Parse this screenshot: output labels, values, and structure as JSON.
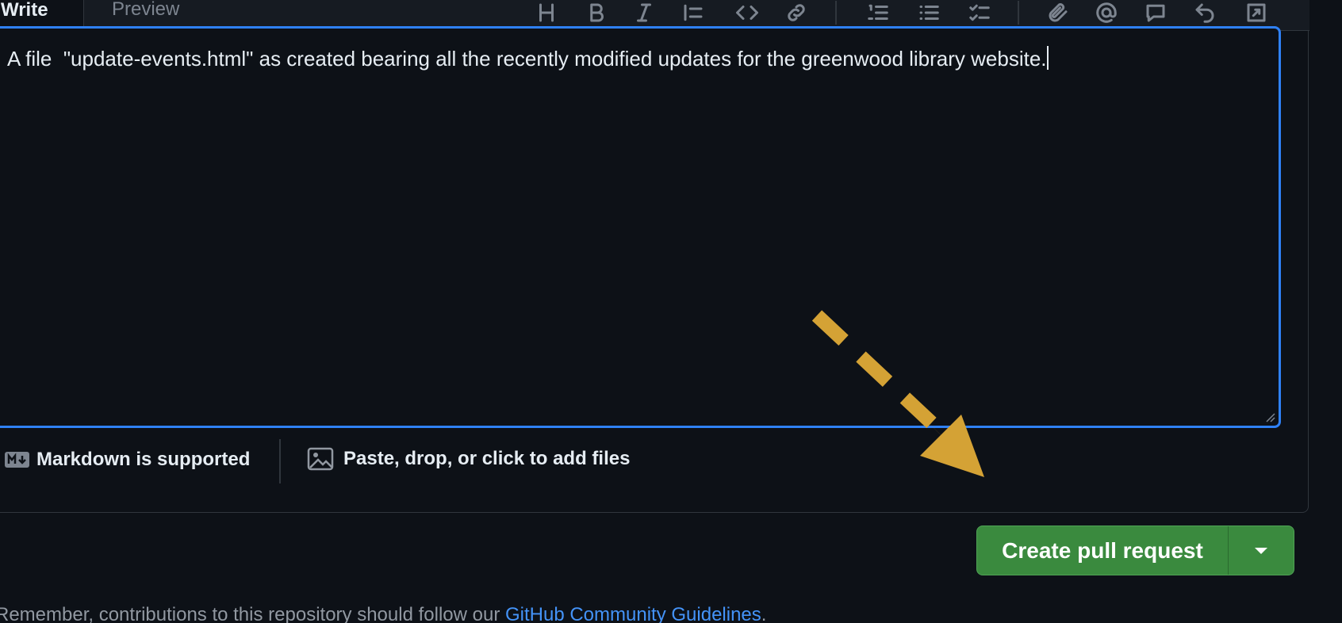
{
  "tabs": {
    "write_label": "Write",
    "preview_label": "Preview"
  },
  "toolbar": {
    "icons": [
      "heading-icon",
      "bold-icon",
      "italic-icon",
      "quote-icon",
      "code-icon",
      "link-icon",
      "numbered-list-icon",
      "unordered-list-icon",
      "task-list-icon",
      "attach-icon",
      "mention-icon",
      "reference-icon",
      "undo-icon",
      "fullscreen-icon"
    ]
  },
  "editor": {
    "text": "A file  \"update-events.html\" as created bearing all the recently modified updates for the greenwood library website."
  },
  "footer": {
    "markdown_label": "Markdown is supported",
    "attach_label": "Paste, drop, or click to add files"
  },
  "actions": {
    "create_label": "Create pull request"
  },
  "notice": {
    "prefix": "Remember, contributions to this repository should follow our ",
    "link_text": "GitHub Community Guidelines",
    "suffix": "."
  },
  "colors": {
    "background": "#0d1117",
    "focus_border": "#2f81f7",
    "primary_button": "#3a8a3e",
    "link": "#4493f8",
    "annotation_arrow": "#d4a235"
  }
}
